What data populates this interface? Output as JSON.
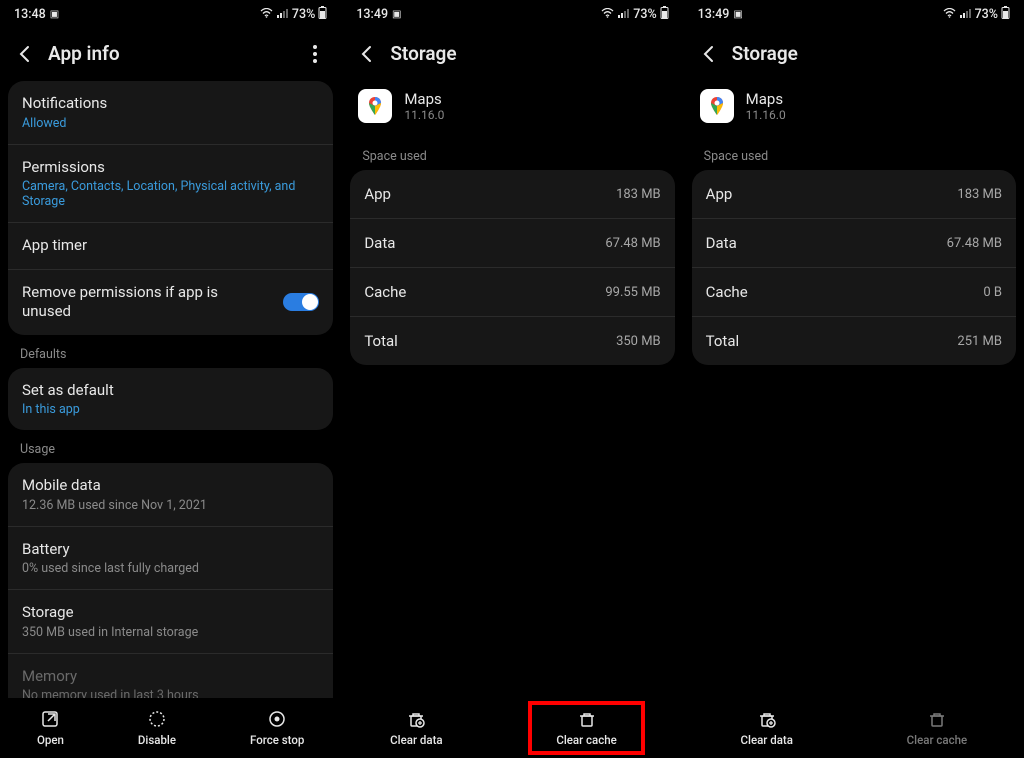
{
  "screens": [
    {
      "status": {
        "time": "13:48",
        "battery": "73%"
      },
      "title": "App info",
      "rows": {
        "notifications": {
          "title": "Notifications",
          "sub": "Allowed"
        },
        "permissions": {
          "title": "Permissions",
          "sub": "Camera, Contacts, Location, Physical activity, and Storage"
        },
        "apptimer": {
          "title": "App timer"
        },
        "removeperms": {
          "title": "Remove permissions if app is unused"
        }
      },
      "sections": {
        "defaults": "Defaults",
        "usage": "Usage"
      },
      "setdefault": {
        "title": "Set as default",
        "sub": "In this app"
      },
      "usage": {
        "mobiledata": {
          "title": "Mobile data",
          "sub": "12.36 MB used since Nov 1, 2021"
        },
        "battery": {
          "title": "Battery",
          "sub": "0% used since last fully charged"
        },
        "storage": {
          "title": "Storage",
          "sub": "350 MB used in Internal storage"
        },
        "memory": {
          "title": "Memory",
          "sub": "No memory used in last 3 hours"
        }
      },
      "bottom": {
        "open": "Open",
        "disable": "Disable",
        "forcestop": "Force stop"
      }
    },
    {
      "status": {
        "time": "13:49",
        "battery": "73%"
      },
      "title": "Storage",
      "app": {
        "name": "Maps",
        "version": "11.16.0"
      },
      "section": "Space used",
      "rows": {
        "app": {
          "k": "App",
          "v": "183 MB"
        },
        "data": {
          "k": "Data",
          "v": "67.48 MB"
        },
        "cache": {
          "k": "Cache",
          "v": "99.55 MB"
        },
        "total": {
          "k": "Total",
          "v": "350 MB"
        }
      },
      "bottom": {
        "cleardata": "Clear data",
        "clearcache": "Clear cache"
      }
    },
    {
      "status": {
        "time": "13:49",
        "battery": "73%"
      },
      "title": "Storage",
      "app": {
        "name": "Maps",
        "version": "11.16.0"
      },
      "section": "Space used",
      "rows": {
        "app": {
          "k": "App",
          "v": "183 MB"
        },
        "data": {
          "k": "Data",
          "v": "67.48 MB"
        },
        "cache": {
          "k": "Cache",
          "v": "0 B"
        },
        "total": {
          "k": "Total",
          "v": "251 MB"
        }
      },
      "bottom": {
        "cleardata": "Clear data",
        "clearcache": "Clear cache"
      }
    }
  ]
}
